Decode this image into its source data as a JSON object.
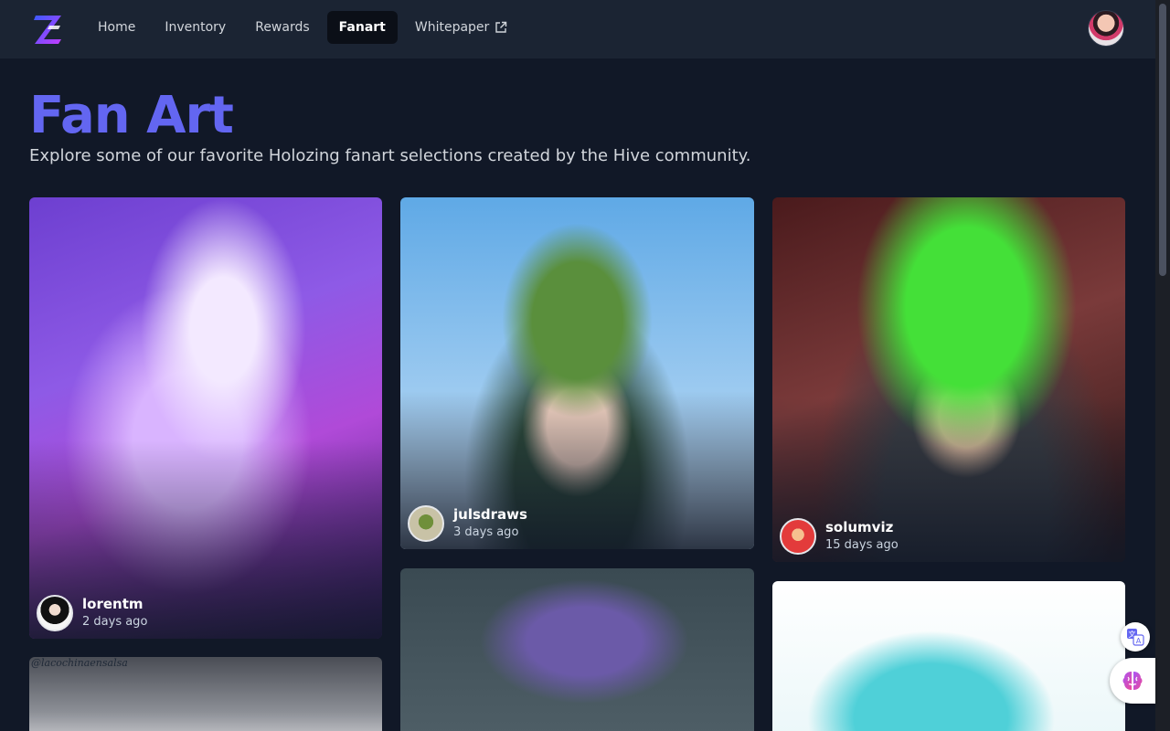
{
  "colors": {
    "accent": "#6366f1",
    "background": "#111827",
    "topbar": "#1b2433"
  },
  "nav": {
    "items": [
      {
        "label": "Home"
      },
      {
        "label": "Inventory"
      },
      {
        "label": "Rewards"
      },
      {
        "label": "Fanart",
        "active": true
      },
      {
        "label": "Whitepaper",
        "icon": "external-link-icon"
      }
    ]
  },
  "header": {
    "title": "Fan Art",
    "subtitle": "Explore some of our favorite Holozing fanart selections created by the Hive community."
  },
  "cards": [
    {
      "user": "lorentm",
      "time": "2 days ago"
    },
    {
      "user": "julsdraws",
      "time": "3 days ago"
    },
    {
      "user": "solumviz",
      "time": "15 days ago"
    },
    {
      "watermark": "@lacochinaensalsa"
    }
  ],
  "floating_buttons": {
    "translate_icon": "translate-icon",
    "brain_icon": "brain-icon"
  }
}
